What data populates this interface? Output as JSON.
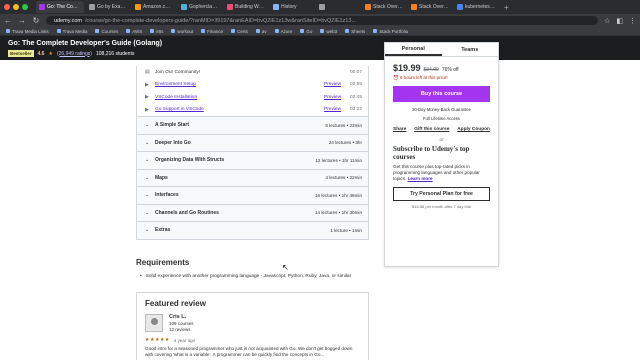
{
  "browser": {
    "tabs": [
      {
        "label": "Go: The Complete Dev",
        "active": true,
        "color": "#a435f0"
      },
      {
        "label": "Go by Example: Func",
        "active": false,
        "color": "#9e9e9e"
      },
      {
        "label": "Amazon.com: Go Pro",
        "active": false,
        "color": "#ff9900"
      },
      {
        "label": "Gopherclass - Codin",
        "active": false,
        "color": "#4fb3d9"
      },
      {
        "label": "Building Web Applic",
        "active": false,
        "color": "#e94e77"
      },
      {
        "label": "History",
        "active": false,
        "color": "#8ab4f8"
      },
      {
        "label": "",
        "active": false,
        "color": "#9e9e9e"
      },
      {
        "label": "Stack Overflow Devel",
        "active": false,
        "color": "#f48024"
      },
      {
        "label": "Stack Overflow Devel",
        "active": false,
        "color": "#f48024"
      },
      {
        "label": "kubernetes - Google",
        "active": false,
        "color": "#4285f4"
      }
    ],
    "url_domain": "udemy.com",
    "url_path": "/course/go-the-complete-developers-guide/?ranMID=39197&ranEAID=bvQ2IE1z13w&ranSiteID=bvQ2IE1z13...",
    "bookmarks": [
      "Trava Media Links",
      "Trava Media",
      "Courses",
      "AWS",
      "k8s",
      "workout",
      "Finance",
      "Certs",
      "av",
      "Azure",
      "Go",
      "web3",
      "Sheets",
      "Stack Portfolio"
    ]
  },
  "course": {
    "title": "Go: The Complete Developer's Guide (Golang)",
    "badge": "Bestseller",
    "rating": "4.6",
    "ratings_count": "(26,949 ratings)",
    "students": "108,216 students"
  },
  "lectures": [
    {
      "title": "Join Our Community!",
      "link": false,
      "preview": "",
      "duration": "00:07",
      "icon": "file-icon"
    },
    {
      "title": "Environment Setup",
      "link": true,
      "preview": "Preview",
      "duration": "02:55",
      "icon": "play-icon"
    },
    {
      "title": "VSCode Installation",
      "link": true,
      "preview": "Preview",
      "duration": "02:45",
      "icon": "play-icon"
    },
    {
      "title": "Go Support in VSCode",
      "link": true,
      "preview": "Preview",
      "duration": "03:22",
      "icon": "play-icon"
    }
  ],
  "sections": [
    {
      "title": "A Simple Start",
      "info": "6 lectures • 23min"
    },
    {
      "title": "Deeper Into Go",
      "info": "24 lectures • 3hr"
    },
    {
      "title": "Organizing Data With Structs",
      "info": "12 lectures • 1hr 11min"
    },
    {
      "title": "Maps",
      "info": "4 lectures • 22min"
    },
    {
      "title": "Interfaces",
      "info": "16 lectures • 1hr 46min"
    },
    {
      "title": "Channels and Go Routines",
      "info": "14 lectures • 1hr 30min"
    },
    {
      "title": "Extras",
      "info": "1 lecture • 1min"
    }
  ],
  "requirements": {
    "heading": "Requirements",
    "items": [
      "Solid experience with another programming language - Javascript, Python, Ruby, Java, or similar"
    ]
  },
  "review": {
    "heading": "Featured review",
    "name": "Cris L.",
    "courses": "109 courses",
    "reviews": "12 reviews",
    "stars": "★★★★★",
    "ago": "a year ago",
    "text": "Good intro for a seasoned programmer who just is not acquainted with Go. We don't get bogged down with covering 'what is a variable'. A programmer can be quickly find the concepts in Go..."
  },
  "sidebar": {
    "tab_personal": "Personal",
    "tab_teams": "Teams",
    "price": "$19.99",
    "original_price": "$84.99",
    "discount": "76% off",
    "timer": "6 hours left at this price!",
    "buy_label": "Buy this course",
    "guarantee": "30-Day Money-Back Guarantee",
    "access": "Full Lifetime Access",
    "share": "Share",
    "gift": "Gift this course",
    "coupon": "Apply Coupon",
    "or": "or",
    "sub_heading": "Subscribe to Udemy's top courses",
    "sub_text": "Get this course plus top-rated picks in programming languages and other popular topics.",
    "learn_more": "Learn more",
    "try_label": "Try Personal Plan for free",
    "after_trial": "$16.58 per month after 7 day trial"
  }
}
